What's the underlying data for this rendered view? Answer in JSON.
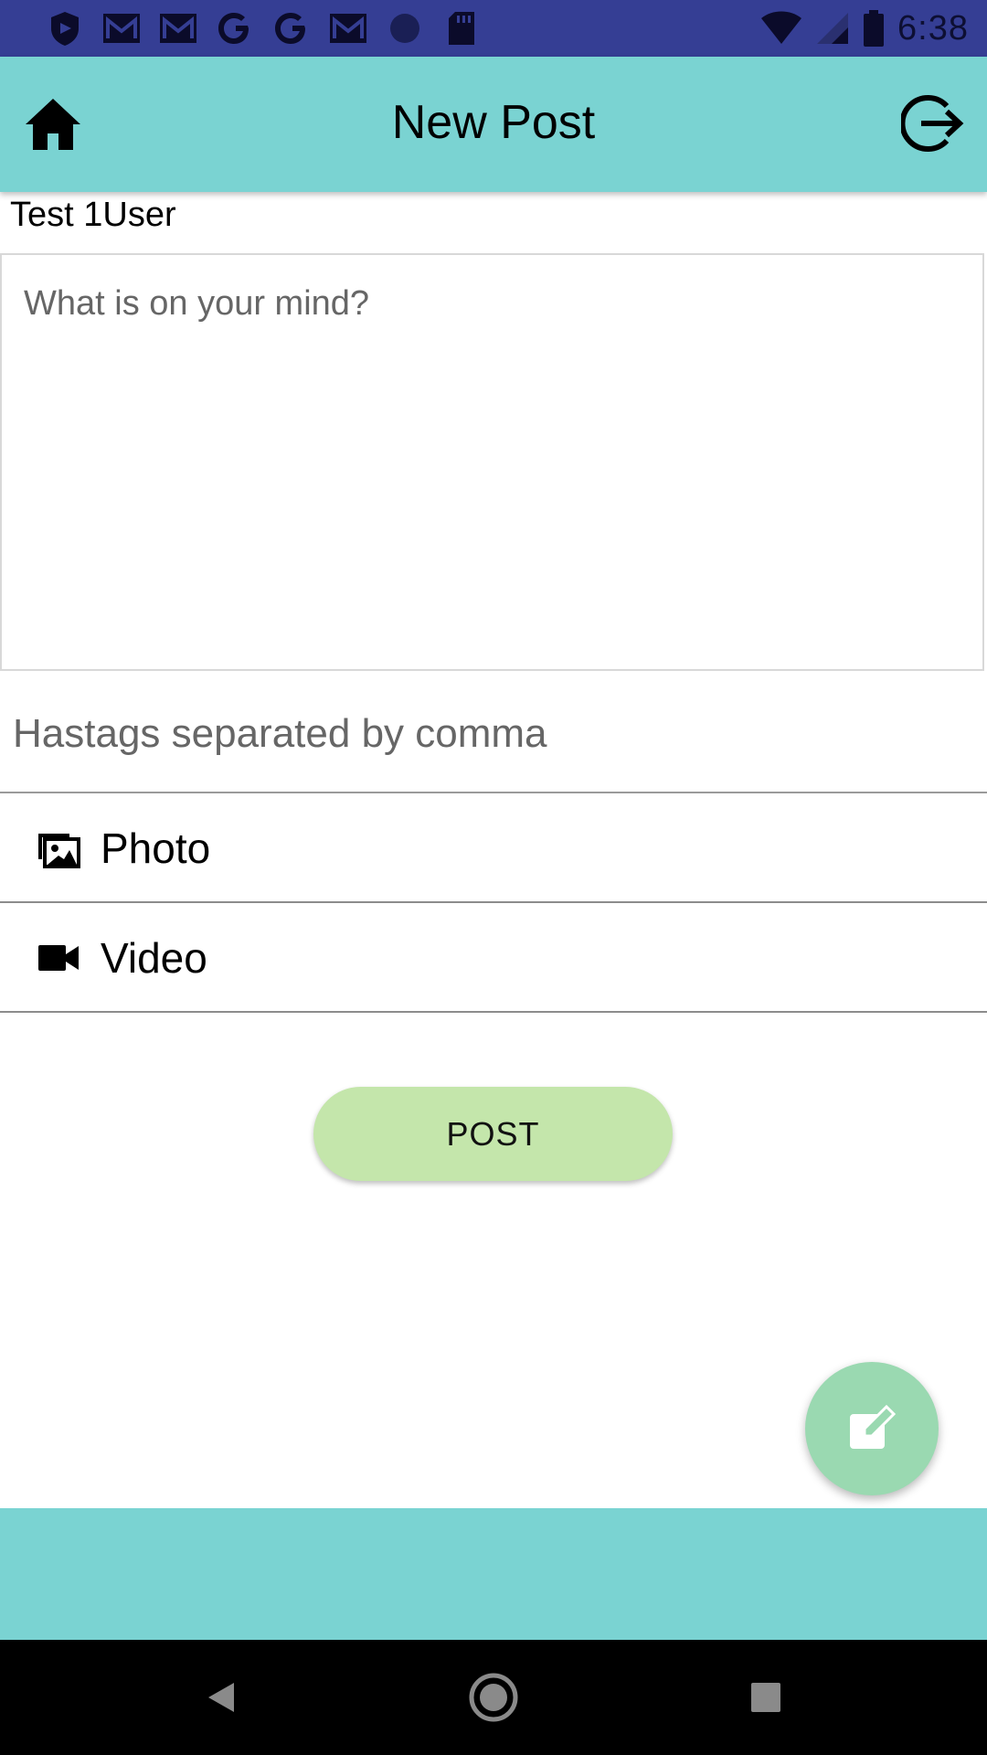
{
  "status_bar": {
    "time": "6:38",
    "left_icons": [
      "shield-icon",
      "gmail-icon",
      "gmail-icon",
      "google-icon",
      "google-icon",
      "gmail-icon",
      "circle-icon",
      "sd-card-icon"
    ],
    "right_icons": [
      "wifi-icon",
      "signal-icon",
      "battery-icon"
    ]
  },
  "app_bar": {
    "title": "New Post",
    "left_icon": "home-icon",
    "right_icon": "logout-icon",
    "color": "#7ad3d2"
  },
  "user": {
    "name": "Test 1User"
  },
  "post_form": {
    "text_value": "",
    "text_placeholder": "What is on your mind?",
    "hashtags_value": "",
    "hashtags_placeholder": "Hastags separated by comma"
  },
  "media": {
    "photo_label": "Photo",
    "photo_icon": "images-icon",
    "video_label": "Video",
    "video_icon": "video-camera-icon"
  },
  "actions": {
    "post_label": "POST",
    "post_color": "#c4e6ab",
    "fab_icon": "edit-icon",
    "fab_color": "#9ad9b1"
  },
  "nav_bar": {
    "icons": [
      "back-icon",
      "home-circle-icon",
      "recents-icon"
    ]
  }
}
